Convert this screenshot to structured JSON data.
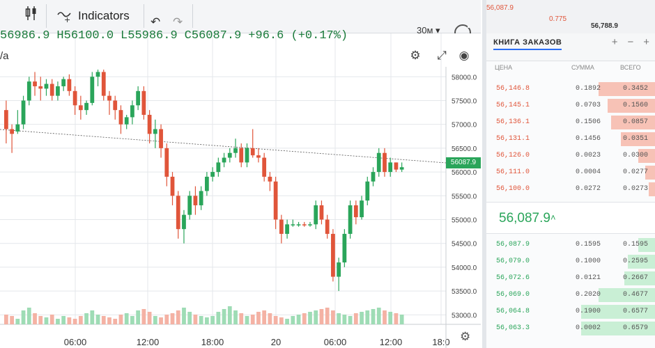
{
  "toolbar": {
    "indicators_label": "Indicators",
    "interval": "30м",
    "ask_price_top": "56,087.9",
    "bid_change_top": "0.775",
    "right_value_top": "56,788.9"
  },
  "legend": {
    "open": "56986.9",
    "high": "H56100.0",
    "low": "L55986.9",
    "close": "C56087.9",
    "change": "+96.6 (+0.17%)",
    "sub": "/a"
  },
  "colors": {
    "up": "#2aa55a",
    "down": "#e0553a",
    "accent": "#2a6df4"
  },
  "chart_data": {
    "type": "candlestick",
    "last_price": 56087.9,
    "last_price_label": "56087.9",
    "y_ticks": [
      "58000.0",
      "57500.0",
      "57000.0",
      "56500.0",
      "56000.0",
      "55500.0",
      "55000.0",
      "54500.0",
      "54000.0",
      "53500.0",
      "53000.0"
    ],
    "x_ticks": [
      "06:00",
      "12:00",
      "18:00",
      "20",
      "06:00",
      "12:00",
      "18:0"
    ],
    "ylim": [
      52800,
      58150
    ],
    "candles": [
      [
        57300,
        57500,
        56600,
        56900
      ],
      [
        56900,
        57000,
        56400,
        56800
      ],
      [
        56850,
        57300,
        56800,
        57000
      ],
      [
        57000,
        57600,
        56900,
        57500
      ],
      [
        57500,
        58000,
        57400,
        57900
      ],
      [
        57900,
        58100,
        57600,
        57800
      ],
      [
        57800,
        58000,
        57500,
        57750
      ],
      [
        57750,
        57950,
        57600,
        57850
      ],
      [
        57850,
        57950,
        57500,
        57600
      ],
      [
        57600,
        57900,
        57500,
        57800
      ],
      [
        57800,
        58000,
        57700,
        57950
      ],
      [
        57950,
        58050,
        57600,
        57700
      ],
      [
        57700,
        57800,
        57200,
        57400
      ],
      [
        57400,
        57600,
        57100,
        57300
      ],
      [
        57300,
        57500,
        57200,
        57450
      ],
      [
        57450,
        58100,
        57400,
        58000
      ],
      [
        58000,
        58150,
        57800,
        58100
      ],
      [
        58100,
        58150,
        57500,
        57600
      ],
      [
        57600,
        57700,
        57200,
        57500
      ],
      [
        57500,
        57600,
        57100,
        57300
      ],
      [
        57300,
        57400,
        56800,
        57000
      ],
      [
        57000,
        57200,
        56900,
        57150
      ],
      [
        57150,
        57500,
        57000,
        57400
      ],
      [
        57400,
        57800,
        57300,
        57700
      ],
      [
        57700,
        57800,
        57100,
        57200
      ],
      [
        57200,
        57300,
        56600,
        56800
      ],
      [
        56800,
        57100,
        56500,
        56900
      ],
      [
        56900,
        57000,
        56300,
        56500
      ],
      [
        56500,
        56600,
        55700,
        55900
      ],
      [
        55900,
        56000,
        55300,
        55500
      ],
      [
        55500,
        55600,
        54600,
        54800
      ],
      [
        54800,
        55200,
        54500,
        55100
      ],
      [
        55100,
        55600,
        55000,
        55500
      ],
      [
        55500,
        55700,
        55100,
        55300
      ],
      [
        55300,
        55700,
        55200,
        55600
      ],
      [
        55600,
        56000,
        55500,
        55900
      ],
      [
        55900,
        56100,
        55800,
        56000
      ],
      [
        56000,
        56300,
        55900,
        56200
      ],
      [
        56200,
        56400,
        56100,
        56300
      ],
      [
        56300,
        56500,
        56200,
        56400
      ],
      [
        56400,
        56700,
        56300,
        56500
      ],
      [
        56500,
        56600,
        56100,
        56200
      ],
      [
        56200,
        56600,
        56100,
        56500
      ],
      [
        56500,
        56900,
        56300,
        56350
      ],
      [
        56350,
        56500,
        56200,
        56300
      ],
      [
        56300,
        56400,
        55800,
        55900
      ],
      [
        55900,
        56000,
        55600,
        55800
      ],
      [
        55800,
        55900,
        54800,
        55000
      ],
      [
        55000,
        55100,
        54500,
        54700
      ],
      [
        54700,
        55000,
        54600,
        54900
      ],
      [
        54900,
        55000,
        54850,
        54900
      ],
      [
        54900,
        54950,
        54850,
        54900
      ],
      [
        54900,
        54950,
        54850,
        54880
      ],
      [
        54880,
        54950,
        54850,
        54900
      ],
      [
        54900,
        55400,
        54800,
        55300
      ],
      [
        55300,
        55400,
        54900,
        55000
      ],
      [
        55000,
        55100,
        54600,
        54700
      ],
      [
        54700,
        54800,
        53700,
        53800
      ],
      [
        53800,
        54200,
        53500,
        54100
      ],
      [
        54100,
        54800,
        54000,
        54700
      ],
      [
        54700,
        55400,
        54600,
        55300
      ],
      [
        55300,
        55400,
        54900,
        55050
      ],
      [
        55050,
        55500,
        55000,
        55400
      ],
      [
        55400,
        55900,
        55300,
        55800
      ],
      [
        55800,
        56100,
        55700,
        56000
      ],
      [
        56000,
        56500,
        55900,
        56400
      ],
      [
        56400,
        56500,
        55900,
        56000
      ],
      [
        56000,
        56300,
        55900,
        56200
      ],
      [
        56200,
        56200,
        56000,
        56050
      ],
      [
        56050,
        56200,
        56000,
        56100
      ]
    ],
    "volumes": [
      0.35,
      0.3,
      0.2,
      0.5,
      0.6,
      0.4,
      0.3,
      0.25,
      0.35,
      0.2,
      0.3,
      0.25,
      0.2,
      0.3,
      0.4,
      0.5,
      0.35,
      0.3,
      0.25,
      0.2,
      0.35,
      0.4,
      0.3,
      0.5,
      0.55,
      0.45,
      0.3,
      0.25,
      0.35,
      0.4,
      0.5,
      0.6,
      0.45,
      0.35,
      0.3,
      0.25,
      0.3,
      0.45,
      0.55,
      0.65,
      0.5,
      0.4,
      0.3,
      0.35,
      0.45,
      0.5,
      0.4,
      0.3,
      0.25,
      0.2,
      0.3,
      0.35,
      0.4,
      0.45,
      0.5,
      0.55,
      0.6,
      0.5,
      0.4,
      0.35,
      0.3,
      0.4,
      0.45,
      0.5,
      0.55,
      0.6,
      0.5,
      0.45,
      0.4,
      0.35
    ]
  },
  "book": {
    "title": "КНИГА ЗАКАЗОВ",
    "col_price": "ЦЕНА",
    "col_qty": "СУММА",
    "col_total": "ВСЕГО",
    "asks": [
      {
        "p": "56,146.8",
        "q": "0.1892",
        "t": "0.3452",
        "w": 0.35
      },
      {
        "p": "56,145.1",
        "q": "0.0703",
        "t": "0.1560",
        "w": 0.3
      },
      {
        "p": "56,136.1",
        "q": "0.1506",
        "t": "0.0857",
        "w": 0.28
      },
      {
        "p": "56,131.1",
        "q": "0.1456",
        "t": "0.0351",
        "w": 0.22
      },
      {
        "p": "56,126.0",
        "q": "0.0023",
        "t": "0.0300",
        "w": 0.12
      },
      {
        "p": "56,111.0",
        "q": "0.0004",
        "t": "0.0277",
        "w": 0.08
      },
      {
        "p": "56,100.0",
        "q": "0.0272",
        "t": "0.0273",
        "w": 0.06
      }
    ],
    "mid_price": "56,087.9",
    "mid_arrow": "˄",
    "bids": [
      {
        "p": "56,087.9",
        "q": "0.1595",
        "t": "0.1595",
        "w": 0.12
      },
      {
        "p": "56,079.0",
        "q": "0.1000",
        "t": "0.2595",
        "w": 0.18
      },
      {
        "p": "56,072.6",
        "q": "0.0121",
        "t": "0.2667",
        "w": 0.2
      },
      {
        "p": "56,069.0",
        "q": "0.2020",
        "t": "0.4677",
        "w": 0.35
      },
      {
        "p": "56,064.8",
        "q": "0.1900",
        "t": "0.6577",
        "w": 0.45
      },
      {
        "p": "56,063.3",
        "q": "0.0002",
        "t": "0.6579",
        "w": 0.45
      }
    ]
  }
}
